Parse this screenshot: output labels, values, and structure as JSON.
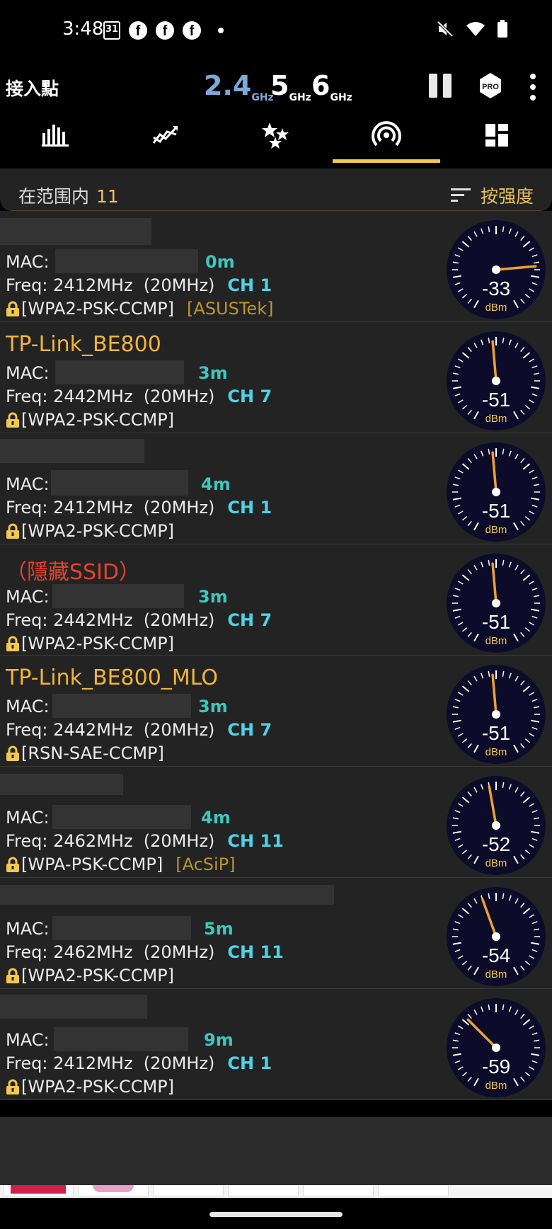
{
  "status_bar": {
    "time": "3:48",
    "calendar_day": "31",
    "left_icons": [
      "calendar-icon",
      "facebook-icon",
      "facebook-icon",
      "facebook-icon",
      "dot-icon"
    ],
    "right_icons": [
      "mute-icon",
      "wifi-icon",
      "battery-icon"
    ]
  },
  "app_bar": {
    "title": "接入點",
    "bands": [
      {
        "value": "2.4",
        "unit": "GHz",
        "active": true
      },
      {
        "value": "5",
        "unit": "GHz",
        "active": false
      },
      {
        "value": "6",
        "unit": "GHz",
        "active": false
      }
    ],
    "pro_label": "PRO"
  },
  "tabs": [
    {
      "icon": "channel-graph-icon",
      "active": false
    },
    {
      "icon": "time-graph-icon",
      "active": false
    },
    {
      "icon": "channel-rating-icon",
      "active": false
    },
    {
      "icon": "access-points-icon",
      "active": true
    },
    {
      "icon": "dashboard-icon",
      "active": false
    }
  ],
  "filter": {
    "in_range_label": "在范围内",
    "in_range_count": "11",
    "sort_label": "按强度"
  },
  "access_points": [
    {
      "ssid": "",
      "mac_label": "MAC: a",
      "distance": "0m",
      "freq": "Freq: 2412MHz  (20MHz)",
      "channel": "CH 1",
      "security": "[WPA2-PSK-CCMP]",
      "vendor": "[ASUSTek]",
      "dbm": -33
    },
    {
      "ssid": "TP-Link_BE800",
      "mac_label": "MAC: ",
      "distance": "3m",
      "freq": "Freq: 2442MHz  (20MHz)",
      "channel": "CH 7",
      "security": "[WPA2-PSK-CCMP]",
      "vendor": "",
      "dbm": -51
    },
    {
      "ssid": "",
      "mac_label": "MAC: ",
      "distance": "4m",
      "freq": "Freq: 2412MHz  (20MHz)",
      "channel": "CH 1",
      "security": "[WPA2-PSK-CCMP]",
      "vendor": "",
      "dbm": -51
    },
    {
      "ssid": "（隱藏SSID）",
      "mac_label": "MAC: ",
      "distance": "3m",
      "freq": "Freq: 2442MHz  (20MHz)",
      "channel": "CH 7",
      "security": "[WPA2-PSK-CCMP]",
      "vendor": "",
      "dbm": -51,
      "hidden": true
    },
    {
      "ssid": "TP-Link_BE800_MLO",
      "mac_label": "MAC: ",
      "distance": "3m",
      "freq": "Freq: 2442MHz  (20MHz)",
      "channel": "CH 7",
      "security": "[RSN-SAE-CCMP]",
      "vendor": "",
      "dbm": -51
    },
    {
      "ssid": "",
      "mac_label": "MAC: ",
      "distance": "4m",
      "freq": "Freq: 2462MHz  (20MHz)",
      "channel": "CH 11",
      "security": "[WPA-PSK-CCMP]",
      "vendor": "[AcSiP]",
      "dbm": -52
    },
    {
      "ssid": "",
      "mac_label": "MAC: ",
      "distance": "5m",
      "freq": "Freq: 2462MHz  (20MHz)",
      "channel": "CH 11",
      "security": "[WPA2-PSK-CCMP]",
      "vendor": "",
      "dbm": -54
    },
    {
      "ssid": "",
      "mac_label": "MAC: ",
      "distance": "9m",
      "freq": "Freq: 2412MHz  (20MHz)",
      "channel": "CH 1",
      "security": "[WPA2-PSK-CCMP]",
      "vendor": "",
      "dbm": -59
    }
  ],
  "gauge_unit": "dBm",
  "colors": {
    "accent": "#f2c94c",
    "ssid": "#f2b43a",
    "hidden_ssid": "#e0442e",
    "distance": "#3ec7bc",
    "channel": "#4fd2e6",
    "vendor": "#b9962f",
    "gauge_face": "#0c0c2a",
    "needle": "#f0a030"
  }
}
